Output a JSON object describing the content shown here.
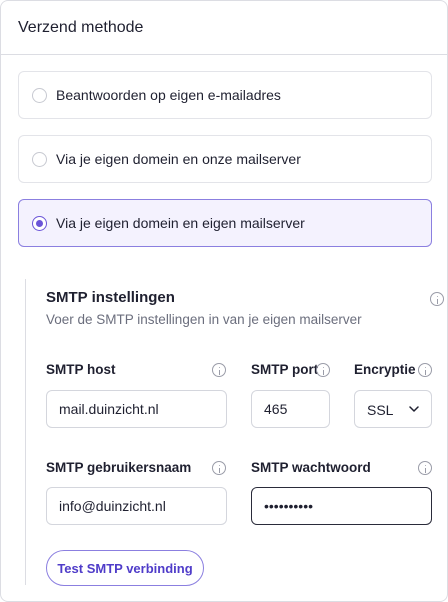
{
  "header": {
    "title": "Verzend methode"
  },
  "options": [
    {
      "label": "Beantwoorden op eigen e-mailadres",
      "selected": false
    },
    {
      "label": "Via je eigen domein en onze mailserver",
      "selected": false
    },
    {
      "label": "Via je eigen domein en eigen mailserver",
      "selected": true
    }
  ],
  "smtp": {
    "title": "SMTP instellingen",
    "subtitle": "Voer de SMTP instellingen in van je eigen mailserver",
    "host": {
      "label": "SMTP host",
      "value": "mail.duinzicht.nl"
    },
    "port": {
      "label": "SMTP port",
      "value": "465"
    },
    "encryption": {
      "label": "Encryptie",
      "value": "SSL"
    },
    "username": {
      "label": "SMTP gebruikersnaam",
      "value": "info@duinzicht.nl"
    },
    "password": {
      "label": "SMTP wachtwoord",
      "value": "••••••••••"
    },
    "test_button": "Test SMTP verbinding"
  },
  "colors": {
    "accent": "#6b55d8",
    "accent_light": "#f4f2fe",
    "border": "#dcdde3"
  },
  "icons": {
    "info": "info-circle-icon",
    "chevron": "chevron-down-icon"
  }
}
